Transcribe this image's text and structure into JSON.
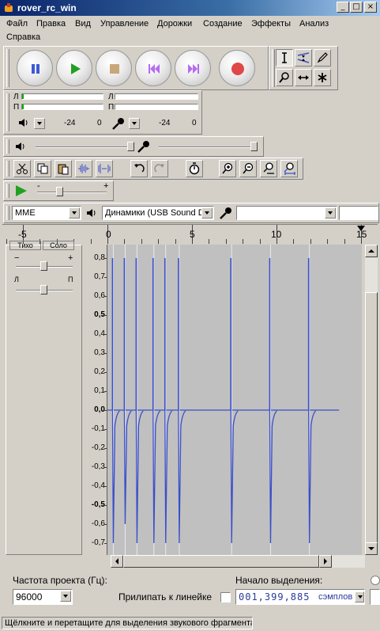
{
  "window": {
    "title": "rover_rc_win",
    "min_label": "_",
    "max_label": "□",
    "close_label": "×"
  },
  "menu": {
    "items": [
      "Файл",
      "Правка",
      "Вид",
      "Управление",
      "Дорожки",
      "Создание",
      "Эффекты",
      "Анализ",
      "Справка"
    ]
  },
  "transport": {
    "buttons": [
      "pause",
      "play",
      "stop",
      "skip-to-start",
      "skip-to-end",
      "record"
    ],
    "colors": {
      "pause": "#3d5bd6",
      "play": "#22a022",
      "stop": "#c8a87a",
      "skip": "#b46cf0",
      "record": "#e04848"
    }
  },
  "tools": [
    "selection-tool",
    "envelope-tool",
    "draw-tool",
    "zoom-tool",
    "time-shift-tool",
    "multi-tool"
  ],
  "meters": {
    "left_label": "Л",
    "right_label": "П",
    "play_min": "-24",
    "play_max": "0",
    "rec_min": "-24",
    "rec_max": "0"
  },
  "mixer": {
    "play_volume_level": 1.0,
    "rec_volume_level": 1.0
  },
  "playat_speed": {
    "minus": "-",
    "plus": "+",
    "level": 0.3
  },
  "device": {
    "host": "MME",
    "output": "Динамики (USB Sound De",
    "input": ""
  },
  "timeline": {
    "labels": [
      "-5",
      "0",
      "5",
      "10",
      "15"
    ],
    "unit_hint": "seconds"
  },
  "track": {
    "tab_labels": [
      "Тихо",
      "Соло"
    ],
    "gain_minus": "−",
    "gain_plus": "+",
    "pan_left": "Л",
    "pan_right": "П"
  },
  "amplitude_labels": [
    "0,8",
    "0,7",
    "0,6",
    "0,5",
    "0,4",
    "0,3",
    "0,2",
    "0,1",
    "0,0",
    "-0,1",
    "-0,2",
    "-0,3",
    "-0,4",
    "-0,5",
    "-0,6",
    "-0,7"
  ],
  "waveform": {
    "color": "#3a4fc8",
    "clip_end_seconds": 13.7,
    "spike_times_seconds": [
      0.3,
      1.0,
      1.7,
      2.7,
      3.4,
      4.2,
      7.3,
      9.6,
      11.9
    ],
    "spike_peaks": [
      0.8,
      0.8,
      0.8,
      0.8,
      0.8,
      0.8,
      0.8,
      0.8,
      0.8
    ],
    "spike_troughs": [
      -0.7,
      -0.6,
      -0.7,
      -0.7,
      -0.7,
      -0.7,
      -0.7,
      -0.7,
      -0.7
    ]
  },
  "selection_bar": {
    "rate_label": "Частота проекта (Гц):",
    "rate_value": "96000",
    "snap_label": "Прилипать к линейке",
    "sel_start_label": "Начало выделения:",
    "sel_start_value": "001,399,885",
    "sel_start_unit": "сэмплов"
  },
  "status": {
    "text": "Щёлкните и перетащите для выделения звукового фрагмента"
  }
}
